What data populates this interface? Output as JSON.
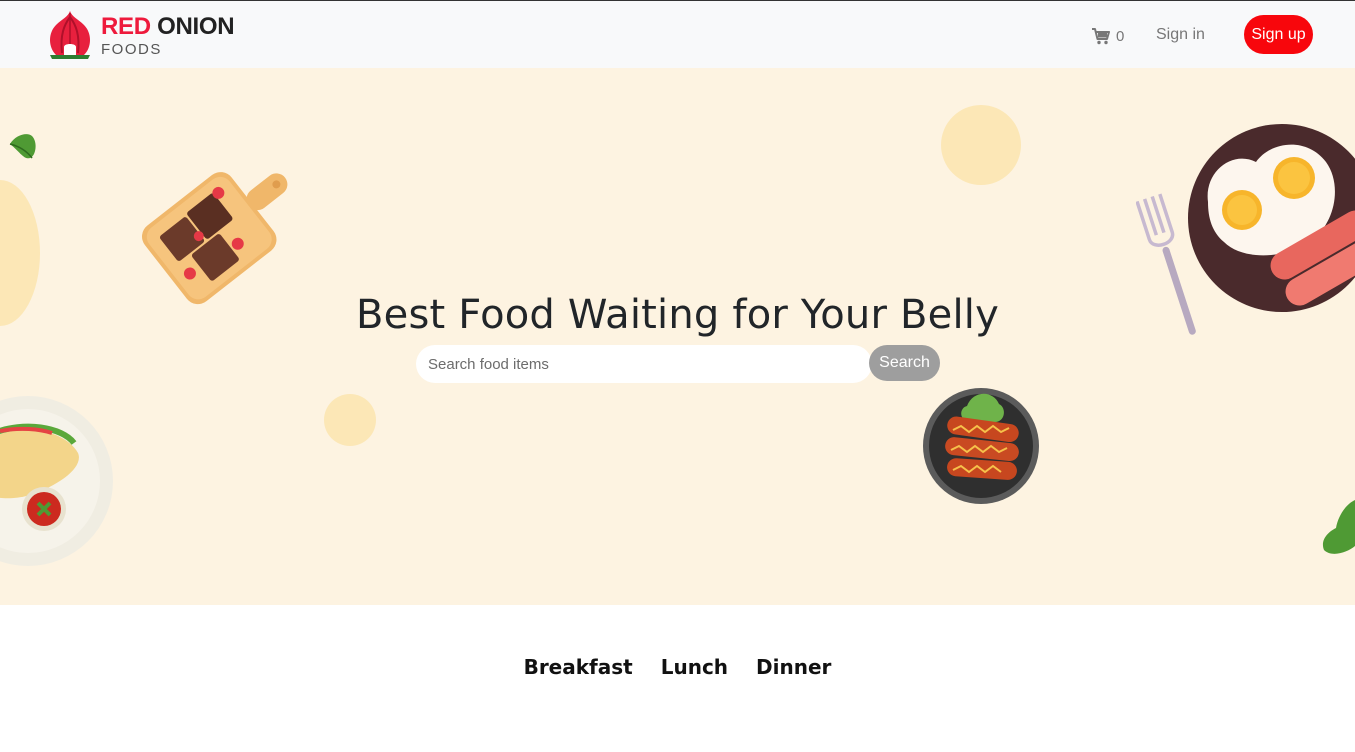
{
  "brand": {
    "name_red": "RED",
    "name_dark": "ONION",
    "subtitle": "FOODS"
  },
  "nav": {
    "cart_count": "0",
    "signin_label": "Sign in",
    "signup_label": "Sign up"
  },
  "hero": {
    "title": "Best Food Waiting for Your Belly",
    "search_placeholder": "Search food items",
    "search_button": "Search"
  },
  "meal_tabs": [
    {
      "label": "Breakfast"
    },
    {
      "label": "Lunch"
    },
    {
      "label": "Dinner"
    }
  ],
  "colors": {
    "brand_red": "#ee1a3c",
    "signup_bg": "#f8060c",
    "hero_bg": "#fdf3e1",
    "search_btn": "#9e9e9e"
  }
}
